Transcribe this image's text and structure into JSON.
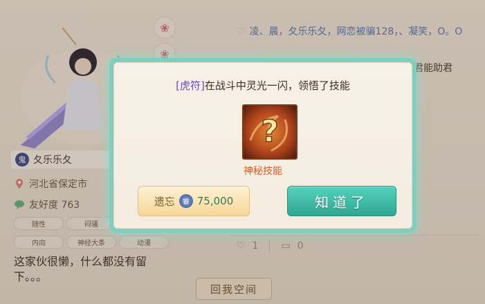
{
  "profile": {
    "name": "夂乐乐夂",
    "badge": "鬼",
    "location": "河北省保定市",
    "favor_label": "友好度 763",
    "tags": [
      "随性",
      "闷骚",
      "内向",
      "神经大条",
      "动漫"
    ],
    "bio": "这家伙很懒，什么都没有留下。。。"
  },
  "feed": {
    "names_line": "凌、晨，夂乐乐夂，网恋被骗128，、凝笑，O。O",
    "snippet": "君能助君",
    "like_count": "1",
    "comment_count": "0"
  },
  "space_button": "回我空间",
  "dialog": {
    "prefix": "[虎符]",
    "message": "在战斗中灵光一闪，领悟了技能",
    "skill_name": "神秘技能",
    "skill_icon": "question-mark-icon",
    "forget_label": "遗忘",
    "currency_icon": "silver-coin-icon",
    "currency_glyph": "银",
    "forget_cost": "75,000",
    "ok_label": "知道了"
  },
  "colors": {
    "ok_button": "#2fa792",
    "forget_button": "#f6d898",
    "highlight": "#6a4bb4",
    "skill_name": "#d85a22",
    "dialog_border": "#7fcfbf"
  }
}
